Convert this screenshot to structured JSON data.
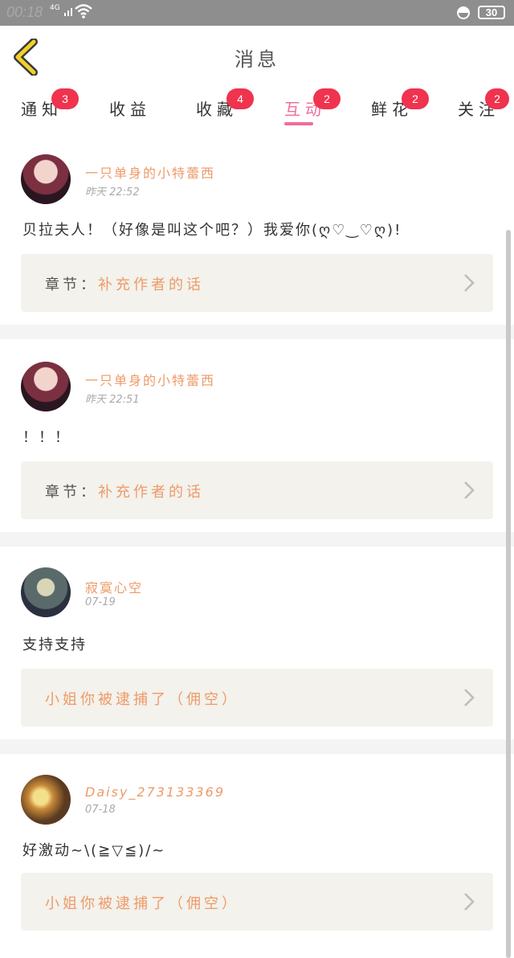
{
  "status_bar": {
    "time": "00:18",
    "network": "4G",
    "battery": "30",
    "icons": [
      "signal-icon",
      "wifi-icon",
      "alarm-icon",
      "battery-icon"
    ]
  },
  "header": {
    "title": "消息",
    "back_icon": "chevron-left-icon",
    "accent_color": "#f3d02a"
  },
  "tabs": [
    {
      "label": "通知",
      "badge": "3",
      "active": false
    },
    {
      "label": "收益",
      "badge": "",
      "active": false
    },
    {
      "label": "收藏",
      "badge": "4",
      "active": false
    },
    {
      "label": "互动",
      "badge": "2",
      "active": true
    },
    {
      "label": "鲜花",
      "badge": "2",
      "active": false
    },
    {
      "label": "关注",
      "badge": "2",
      "active": false
    }
  ],
  "colors": {
    "active_tab": "#f06c9b",
    "badge": "#f0334e",
    "name": "#ee9a68",
    "chapter_bg": "#f3f2ec"
  },
  "messages": [
    {
      "user": "一只单身的小特蕾西",
      "time": "昨天 22:52",
      "content": "贝拉夫人！（好像是叫这个吧？）我爱你(ღ♡‿♡ღ)!",
      "chapter_prefix": "章节：",
      "chapter": "补充作者的话"
    },
    {
      "user": "一只单身的小特蕾西",
      "time": "昨天 22:51",
      "content": "！！！",
      "chapter_prefix": "章节：",
      "chapter": "补充作者的话"
    },
    {
      "user": "寂寞心空",
      "time": "07-19",
      "content": "支持支持",
      "chapter_prefix": "",
      "chapter": "小姐你被逮捕了（佣空）"
    },
    {
      "user": "Daisy_273133369",
      "time": "07-18",
      "content": "好激动~\\(≧▽≦)/~",
      "chapter_prefix": "",
      "chapter": "小姐你被逮捕了（佣空）"
    }
  ]
}
